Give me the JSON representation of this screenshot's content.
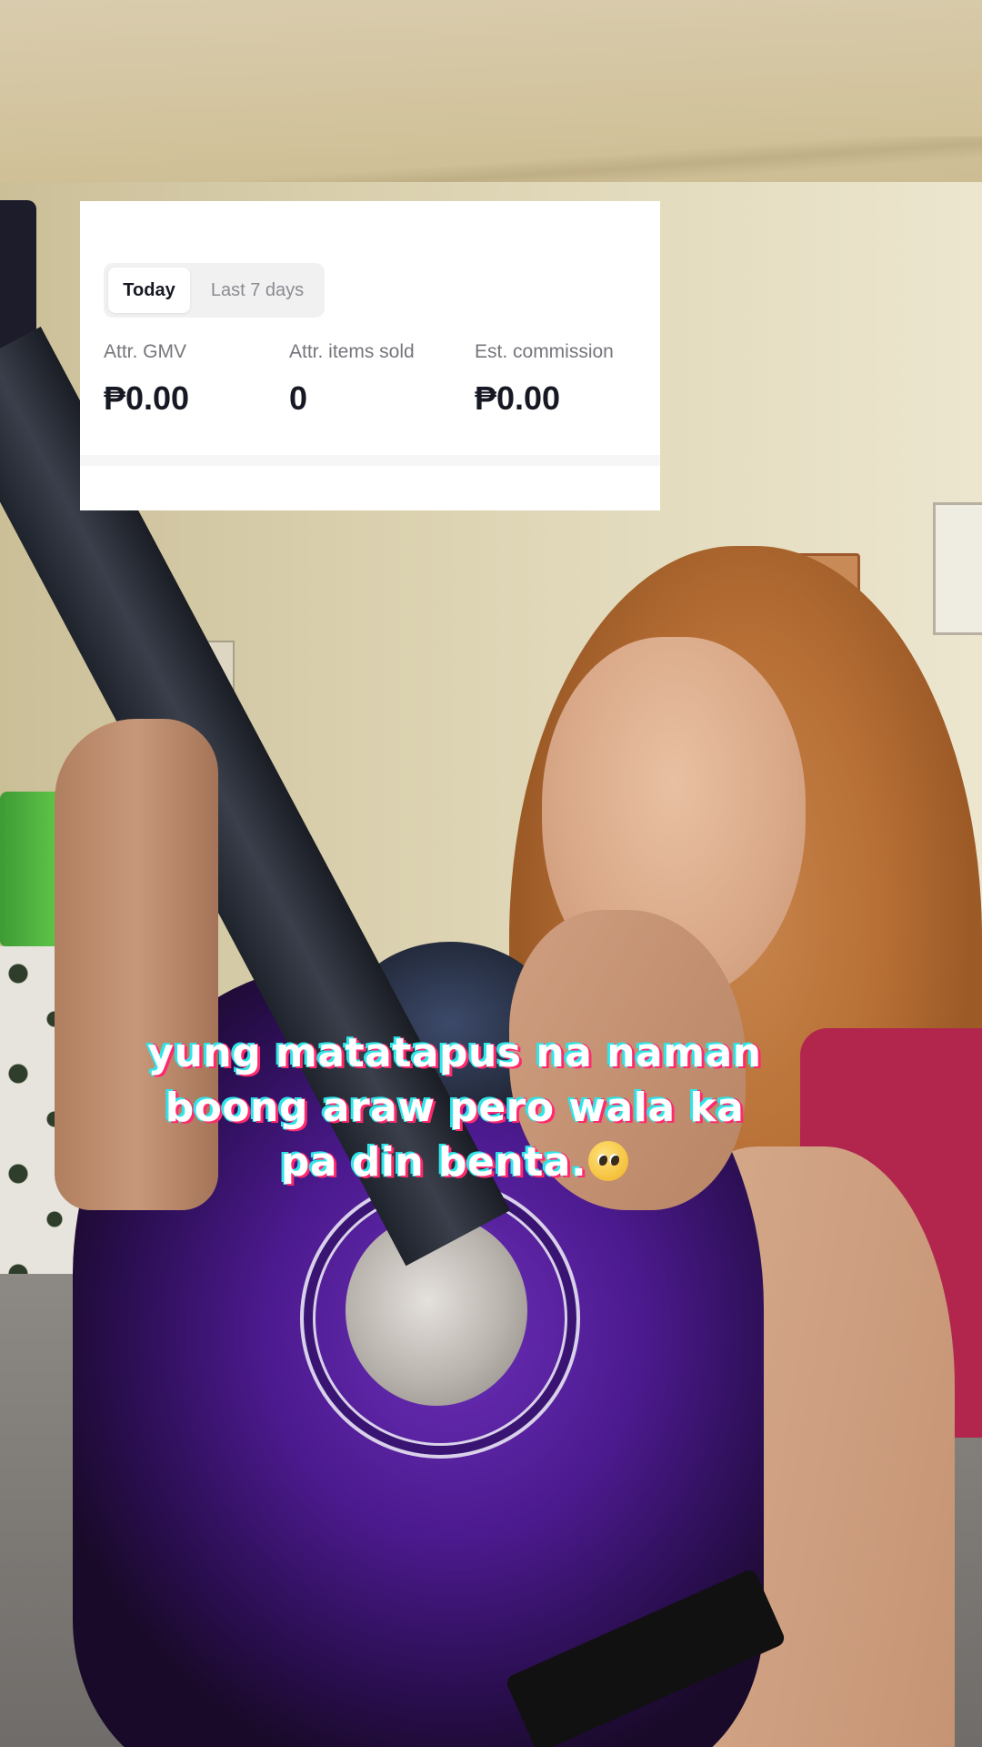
{
  "stats_card": {
    "tabs": [
      {
        "label": "Today",
        "active": true
      },
      {
        "label": "Last 7 days",
        "active": false
      }
    ],
    "metrics": [
      {
        "label": "Attr. GMV",
        "value": "₱0.00"
      },
      {
        "label": "Attr. items sold",
        "value": "0"
      },
      {
        "label": "Est. commission",
        "value": "₱0.00"
      }
    ]
  },
  "caption": {
    "lines": [
      "yung matatapus na naman",
      "boong araw pero wala ka",
      "pa din benta."
    ],
    "emoji": "pleading-face-emoji"
  },
  "colors": {
    "caption_text": "#ffffff",
    "caption_shadow_cyan": "#2ee6ea",
    "caption_shadow_pink": "#ff2a6d",
    "card_background": "#ffffff",
    "guitar_purple": "#4c1a8f"
  }
}
